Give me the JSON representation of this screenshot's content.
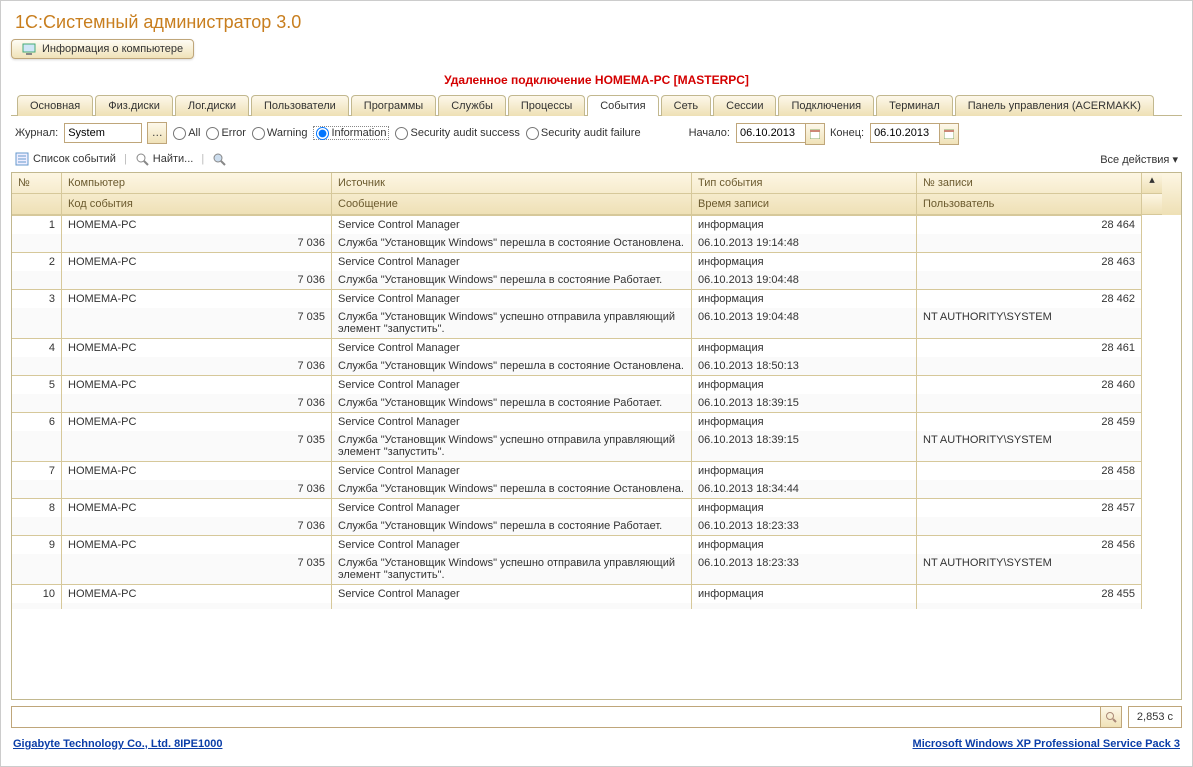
{
  "title": "1С:Системный администратор 3.0",
  "info_button": "Информация о компьютере",
  "remote_line": "Удаленное подключение HOMEMA-PC [MASTERPC]",
  "tabs": [
    "Основная",
    "Физ.диски",
    "Лог.диски",
    "Пользователи",
    "Программы",
    "Службы",
    "Процессы",
    "События",
    "Сеть",
    "Сессии",
    "Подключения",
    "Терминал",
    "Панель управления (ACERMAKK)"
  ],
  "active_tab_index": 7,
  "filter": {
    "journal_label": "Журнал:",
    "journal_value": "System",
    "radios": [
      "All",
      "Error",
      "Warning",
      "Information",
      "Security audit success",
      "Security audit failure"
    ],
    "selected_radio_index": 3,
    "start_label": "Начало:",
    "start_value": "06.10.2013",
    "end_label": "Конец:",
    "end_value": "06.10.2013"
  },
  "toolbar": {
    "list": "Список событий",
    "find": "Найти...",
    "all_actions": "Все действия"
  },
  "columns_top": [
    "№",
    "Компьютер",
    "Источник",
    "Тип события",
    "№ записи"
  ],
  "columns_bot": [
    "",
    "Код события",
    "Сообщение",
    "Время записи",
    "Пользователь"
  ],
  "rows": [
    {
      "n": "1",
      "computer": "HOMEMA-PC",
      "source": "Service Control Manager",
      "etype": "информация",
      "recid": "28 464",
      "code": "7 036",
      "msg": "Служба \"Установщик Windows\" перешла в состояние Остановлена.",
      "time": "06.10.2013 19:14:48",
      "user": ""
    },
    {
      "n": "2",
      "computer": "HOMEMA-PC",
      "source": "Service Control Manager",
      "etype": "информация",
      "recid": "28 463",
      "code": "7 036",
      "msg": "Служба \"Установщик Windows\" перешла в состояние Работает.",
      "time": "06.10.2013 19:04:48",
      "user": ""
    },
    {
      "n": "3",
      "computer": "HOMEMA-PC",
      "source": "Service Control Manager",
      "etype": "информация",
      "recid": "28 462",
      "code": "7 035",
      "msg": "Служба \"Установщик Windows\" успешно отправила управляющий элемент \"запустить\".",
      "time": "06.10.2013 19:04:48",
      "user": "NT AUTHORITY\\SYSTEM"
    },
    {
      "n": "4",
      "computer": "HOMEMA-PC",
      "source": "Service Control Manager",
      "etype": "информация",
      "recid": "28 461",
      "code": "7 036",
      "msg": "Служба \"Установщик Windows\" перешла в состояние Остановлена.",
      "time": "06.10.2013 18:50:13",
      "user": ""
    },
    {
      "n": "5",
      "computer": "HOMEMA-PC",
      "source": "Service Control Manager",
      "etype": "информация",
      "recid": "28 460",
      "code": "7 036",
      "msg": "Служба \"Установщик Windows\" перешла в состояние Работает.",
      "time": "06.10.2013 18:39:15",
      "user": ""
    },
    {
      "n": "6",
      "computer": "HOMEMA-PC",
      "source": "Service Control Manager",
      "etype": "информация",
      "recid": "28 459",
      "code": "7 035",
      "msg": "Служба \"Установщик Windows\" успешно отправила управляющий элемент \"запустить\".",
      "time": "06.10.2013 18:39:15",
      "user": "NT AUTHORITY\\SYSTEM"
    },
    {
      "n": "7",
      "computer": "HOMEMA-PC",
      "source": "Service Control Manager",
      "etype": "информация",
      "recid": "28 458",
      "code": "7 036",
      "msg": "Служба \"Установщик Windows\" перешла в состояние Остановлена.",
      "time": "06.10.2013 18:34:44",
      "user": ""
    },
    {
      "n": "8",
      "computer": "HOMEMA-PC",
      "source": "Service Control Manager",
      "etype": "информация",
      "recid": "28 457",
      "code": "7 036",
      "msg": "Служба \"Установщик Windows\" перешла в состояние Работает.",
      "time": "06.10.2013 18:23:33",
      "user": ""
    },
    {
      "n": "9",
      "computer": "HOMEMA-PC",
      "source": "Service Control Manager",
      "etype": "информация",
      "recid": "28 456",
      "code": "7 035",
      "msg": "Служба \"Установщик Windows\" успешно отправила управляющий элемент \"запустить\".",
      "time": "06.10.2013 18:23:33",
      "user": "NT AUTHORITY\\SYSTEM"
    },
    {
      "n": "10",
      "computer": "HOMEMA-PC",
      "source": "Service Control Manager",
      "etype": "информация",
      "recid": "28 455",
      "code": "",
      "msg": "",
      "time": "",
      "user": ""
    }
  ],
  "count_box": "2,853 с",
  "footer_left": "Gigabyte Technology Co., Ltd. 8IPE1000",
  "footer_right": "Microsoft Windows XP Professional Service Pack 3"
}
